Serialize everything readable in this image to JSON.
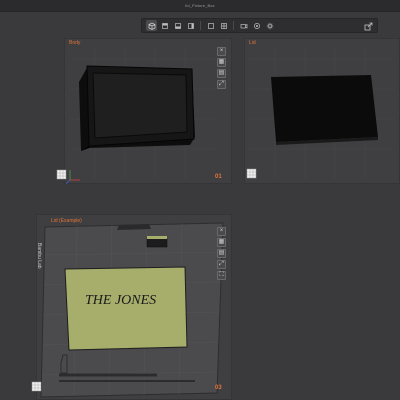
{
  "window": {
    "title": "lid_Picture_Box"
  },
  "toolbar": {
    "buttons": [
      {
        "icon": "perspective-cube-icon"
      },
      {
        "icon": "top-view-icon"
      },
      {
        "icon": "front-view-icon"
      },
      {
        "icon": "side-view-icon"
      },
      {
        "icon": "single-view-icon"
      },
      {
        "icon": "quad-view-icon"
      },
      {
        "icon": "camera-icon"
      },
      {
        "icon": "render-icon"
      },
      {
        "icon": "settings-icon"
      }
    ],
    "right_icon": "export-icon"
  },
  "viewports": {
    "top_left": {
      "label": "Body",
      "number": "01"
    },
    "top_right": {
      "label": "Lid"
    },
    "bottom": {
      "label": "Lid (Example)",
      "number": "03",
      "printer_label": "Bambu Lab",
      "lid_text": "THE JONES"
    }
  },
  "colors": {
    "accent": "#e2743a",
    "bed": "#4a4a4c",
    "lid_panel": "#a7ae6c",
    "object": "#111111"
  }
}
